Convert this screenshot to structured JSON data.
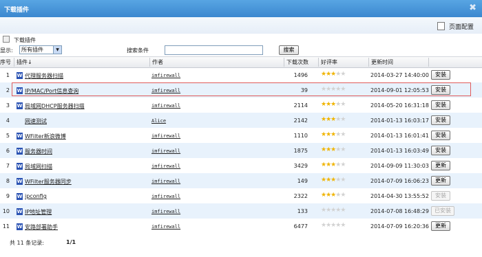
{
  "window": {
    "title": "下载插件",
    "close_icon": "close-icon"
  },
  "toolbar": {
    "page_config": "页面配置"
  },
  "breadcrumb": "下载插件",
  "filter": {
    "show_label": "显示:",
    "show_value": "所有插件",
    "search_label": "搜索条件",
    "search_value": "",
    "search_button": "搜索"
  },
  "table": {
    "headers": {
      "num": "序号",
      "plugin": "插件↓",
      "author": "作者",
      "downloads": "下载次数",
      "rating": "好评率",
      "updated": "更新时间"
    },
    "rows": [
      {
        "num": "1",
        "name": "代理服务器扫描",
        "author": "imfirewall",
        "downloads": "1496",
        "stars": 3.5,
        "time": "2014-03-27 14:40:00",
        "action": "安装",
        "disabled": false,
        "icon": true
      },
      {
        "num": "2",
        "name": "IP/MAC/Port信息查询",
        "author": "imfirewall",
        "downloads": "39",
        "stars": 0,
        "time": "2014-09-01 12:05:53",
        "action": "安装",
        "disabled": false,
        "icon": true
      },
      {
        "num": "3",
        "name": "局域网DHCP服务器扫描",
        "author": "imfirewall",
        "downloads": "2114",
        "stars": 3,
        "time": "2014-05-20 16:31:18",
        "action": "安装",
        "disabled": false,
        "icon": true
      },
      {
        "num": "4",
        "name": "网速测试",
        "author": "Alice",
        "downloads": "2142",
        "stars": 3.5,
        "time": "2014-01-13 16:03:17",
        "action": "安装",
        "disabled": false,
        "icon": false
      },
      {
        "num": "5",
        "name": "WFilter新浪微博",
        "author": "imfirewall",
        "downloads": "1110",
        "stars": 3.5,
        "time": "2014-01-13 16:01:41",
        "action": "安装",
        "disabled": false,
        "icon": true
      },
      {
        "num": "6",
        "name": "服务器时间",
        "author": "imfirewall",
        "downloads": "1875",
        "stars": 3.5,
        "time": "2014-01-13 16:03:49",
        "action": "安装",
        "disabled": false,
        "icon": true
      },
      {
        "num": "7",
        "name": "局域网扫描",
        "author": "imfirewall",
        "downloads": "3429",
        "stars": 3.5,
        "time": "2014-09-09 11:30:03",
        "action": "更新",
        "disabled": false,
        "icon": true
      },
      {
        "num": "8",
        "name": "WFilter服务器同步",
        "author": "imfirewall",
        "downloads": "149",
        "stars": 3.5,
        "time": "2014-07-09 16:06:23",
        "action": "更新",
        "disabled": false,
        "icon": true
      },
      {
        "num": "9",
        "name": "ipconfig",
        "author": "imfirewall",
        "downloads": "2322",
        "stars": 3.5,
        "time": "2014-04-30 13:55:52",
        "action": "安装",
        "disabled": true,
        "icon": true
      },
      {
        "num": "10",
        "name": "IP地址管理",
        "author": "imfirewall",
        "downloads": "133",
        "stars": 0,
        "time": "2014-07-08 16:48:29",
        "action": "已安装",
        "disabled": true,
        "icon": true
      },
      {
        "num": "11",
        "name": "安路部署助手",
        "author": "imfirewall",
        "downloads": "6477",
        "stars": 0,
        "time": "2014-07-09 16:20:36",
        "action": "更新",
        "disabled": false,
        "icon": true
      }
    ]
  },
  "footer": {
    "total": "共 11 条记录:",
    "pages": "1/1"
  }
}
